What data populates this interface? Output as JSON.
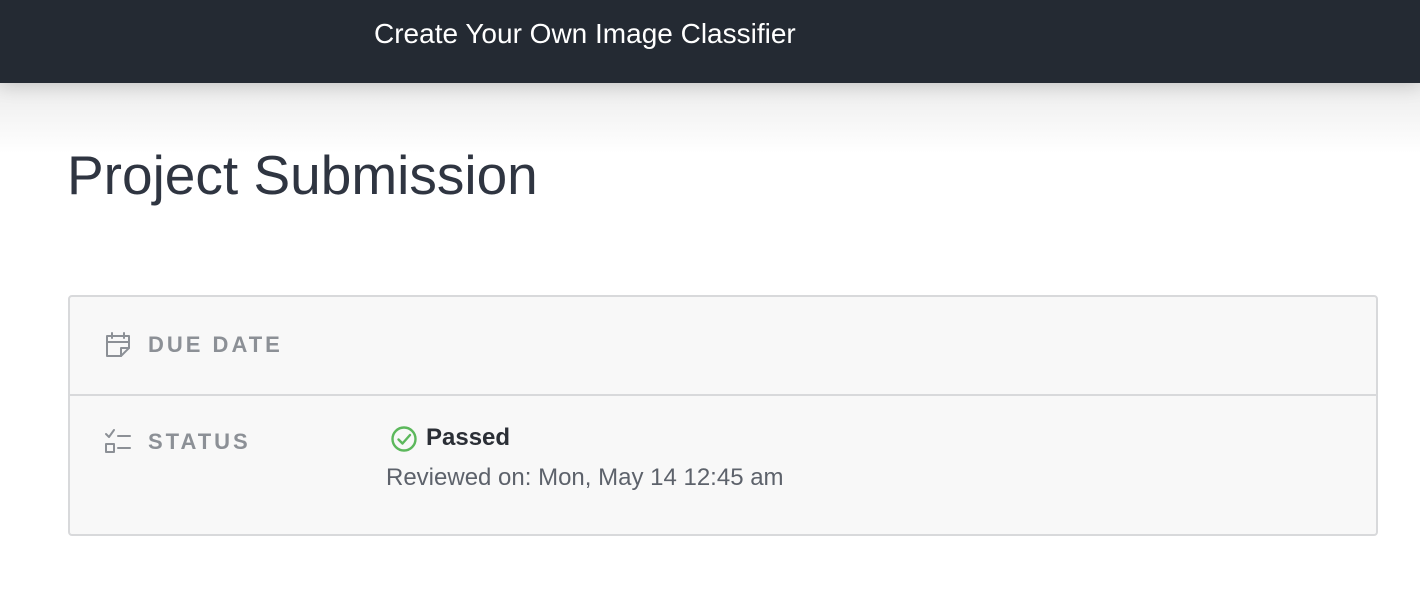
{
  "header": {
    "title": "Create Your Own Image Classifier"
  },
  "page": {
    "title": "Project Submission"
  },
  "details": {
    "due_date": {
      "label": "DUE DATE",
      "icon": "calendar-icon"
    },
    "status": {
      "label": "STATUS",
      "icon": "checklist-icon",
      "value": "Passed",
      "value_icon": "check-circle-icon",
      "reviewed": "Reviewed on: Mon, May 14 12:45 am"
    }
  },
  "colors": {
    "header_bg": "#242a33",
    "success": "#5cb85c",
    "label": "#8c9096",
    "card_bg": "#f8f8f8"
  }
}
